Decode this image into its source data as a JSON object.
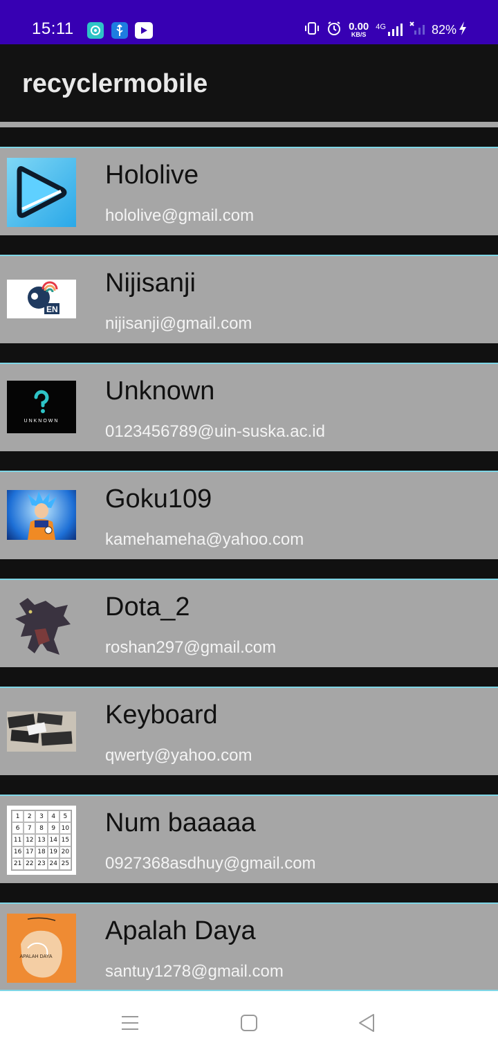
{
  "status_bar": {
    "time": "15:11",
    "app_icons": [
      "chat-bubble-icon",
      "usb-icon",
      "youtube-icon"
    ],
    "speed_value": "0.00",
    "speed_unit": "KB/S",
    "network": "4G",
    "battery": "82%",
    "accent": "#3700b3"
  },
  "app_bar": {
    "title": "recyclermobile"
  },
  "items": [
    {
      "name": "Hololive",
      "email": "hololive@gmail.com",
      "thumbnail": "play-logo"
    },
    {
      "name": "Nijisanji",
      "email": "nijisanji@gmail.com",
      "thumbnail": "nijisanji-en-logo",
      "thumbnail_text": "EN"
    },
    {
      "name": "Unknown",
      "email": "0123456789@uin-suska.ac.id",
      "thumbnail": "unknown-logo",
      "thumbnail_text": "UNKNOWN"
    },
    {
      "name": "Goku109",
      "email": "kamehameha@yahoo.com",
      "thumbnail": "goku-image"
    },
    {
      "name": "Dota_2",
      "email": "roshan297@gmail.com",
      "thumbnail": "roshan-image"
    },
    {
      "name": "Keyboard",
      "email": "qwerty@yahoo.com",
      "thumbnail": "keyboard-photo"
    },
    {
      "name": "Num baaaaa",
      "email": "0927368asdhuy@gmail.com",
      "thumbnail": "number-grid",
      "grid": [
        "1",
        "2",
        "3",
        "4",
        "5",
        "6",
        "7",
        "8",
        "9",
        "10",
        "11",
        "12",
        "13",
        "14",
        "15",
        "16",
        "17",
        "18",
        "19",
        "20",
        "21",
        "22",
        "23",
        "24",
        "25"
      ]
    },
    {
      "name": "Apalah Daya",
      "email": "santuy1278@gmail.com",
      "thumbnail": "apalah-daya-cover",
      "thumbnail_text": "APALAH DAYA"
    }
  ],
  "nav_bar": {
    "buttons": [
      "menu-icon",
      "home-icon",
      "back-icon"
    ]
  }
}
